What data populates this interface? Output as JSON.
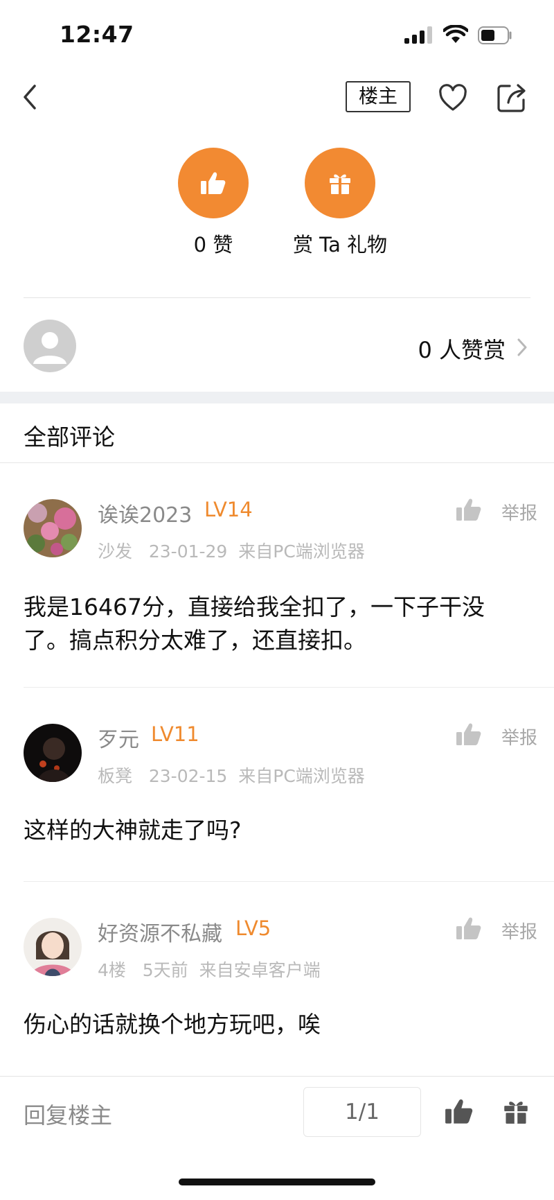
{
  "status_bar": {
    "time": "12:47"
  },
  "nav": {
    "owner_label": "楼主"
  },
  "reward": {
    "like_label": "0 赞",
    "gift_label": "赏 Ta 礼物"
  },
  "supporters": {
    "label": "0 人赞赏"
  },
  "section_title": "全部评论",
  "comments": [
    {
      "name": "诶诶2023",
      "level": "LV14",
      "floor": "沙发",
      "date": "23-01-29",
      "source": "来自PC端浏览器",
      "report": "举报",
      "body": "我是16467分，直接给我全扣了，一下子干没了。搞点积分太难了，还直接扣。"
    },
    {
      "name": "歹元",
      "level": "LV11",
      "floor": "板凳",
      "date": "23-02-15",
      "source": "来自PC端浏览器",
      "report": "举报",
      "body": "这样的大神就走了吗?"
    },
    {
      "name": "好资源不私藏",
      "level": "LV5",
      "floor": "4楼",
      "date": "5天前",
      "source": "来自安卓客户端",
      "report": "举报",
      "body": "伤心的话就换个地方玩吧，唉"
    }
  ],
  "bottom_bar": {
    "reply_placeholder": "回复楼主",
    "page": "1/1"
  },
  "colors": {
    "accent": "#f28a32",
    "level": "#ef8a2e",
    "muted": "#8a8a8a"
  }
}
